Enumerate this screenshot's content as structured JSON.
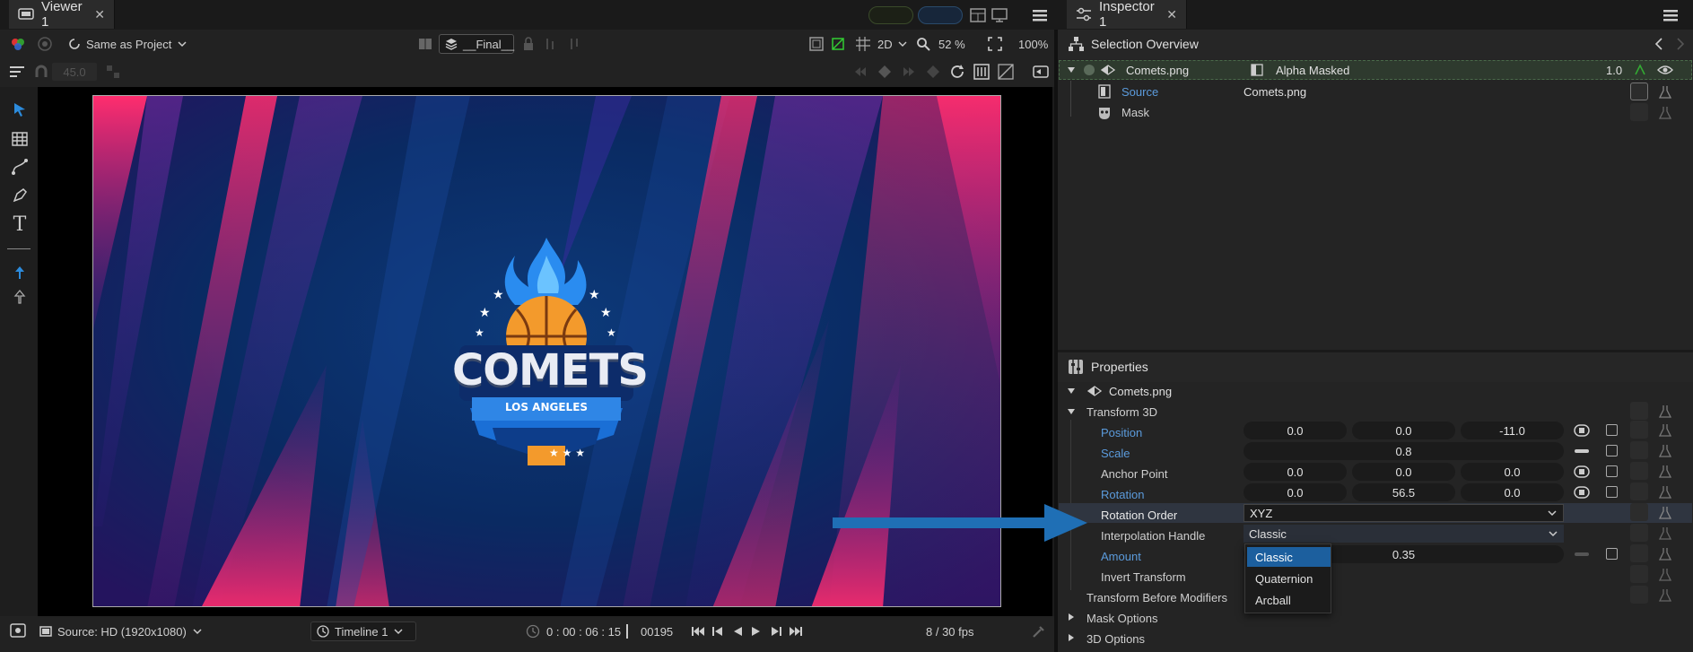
{
  "viewer": {
    "tab_label": "Viewer 1",
    "resolution_mode": "Same as Project",
    "layer_name": "__Final__",
    "view_mode": "2D",
    "zoom_percent": "52 %",
    "zoom_fit": "100%",
    "angle_value": "45.0",
    "logo_text": "COMETS",
    "logo_subtext": "LOS ANGELES",
    "footer": {
      "source": "Source: HD (1920x1080)",
      "timeline": "Timeline 1",
      "timecode": "0 : 00 : 06 : 15",
      "frame": "00195",
      "fps": "8 / 30 fps"
    }
  },
  "inspector": {
    "tab_label": "Inspector 1",
    "selection_title": "Selection Overview",
    "layer": {
      "name": "Comets.png",
      "blend": "Alpha Masked",
      "opacity": "1.0",
      "source_label": "Source",
      "source_value": "Comets.png",
      "mask_label": "Mask"
    },
    "properties_title": "Properties",
    "properties": {
      "object_name": "Comets.png",
      "group_transform": "Transform 3D",
      "position_label": "Position",
      "position": [
        "0.0",
        "0.0",
        "-11.0"
      ],
      "scale_label": "Scale",
      "scale": "0.8",
      "anchor_label": "Anchor Point",
      "anchor": [
        "0.0",
        "0.0",
        "0.0"
      ],
      "rotation_label": "Rotation",
      "rotation": [
        "0.0",
        "56.5",
        "0.0"
      ],
      "rotation_order_label": "Rotation Order",
      "rotation_order_value": "XYZ",
      "interp_label": "Interpolation Handle",
      "interp_value": "Classic",
      "amount_label": "Amount",
      "amount_value": "0.35",
      "invert_label": "Invert Transform",
      "before_mod_label": "Transform Before Modifiers",
      "mask_options_label": "Mask Options",
      "options3d_label": "3D Options",
      "dropdown_options": [
        "Classic",
        "Quaternion",
        "Arcball"
      ]
    }
  },
  "colors": {
    "accent_blue": "#2c8bdc",
    "arrow_blue": "#1f6fb5",
    "selected_option": "#1c5f9e"
  }
}
